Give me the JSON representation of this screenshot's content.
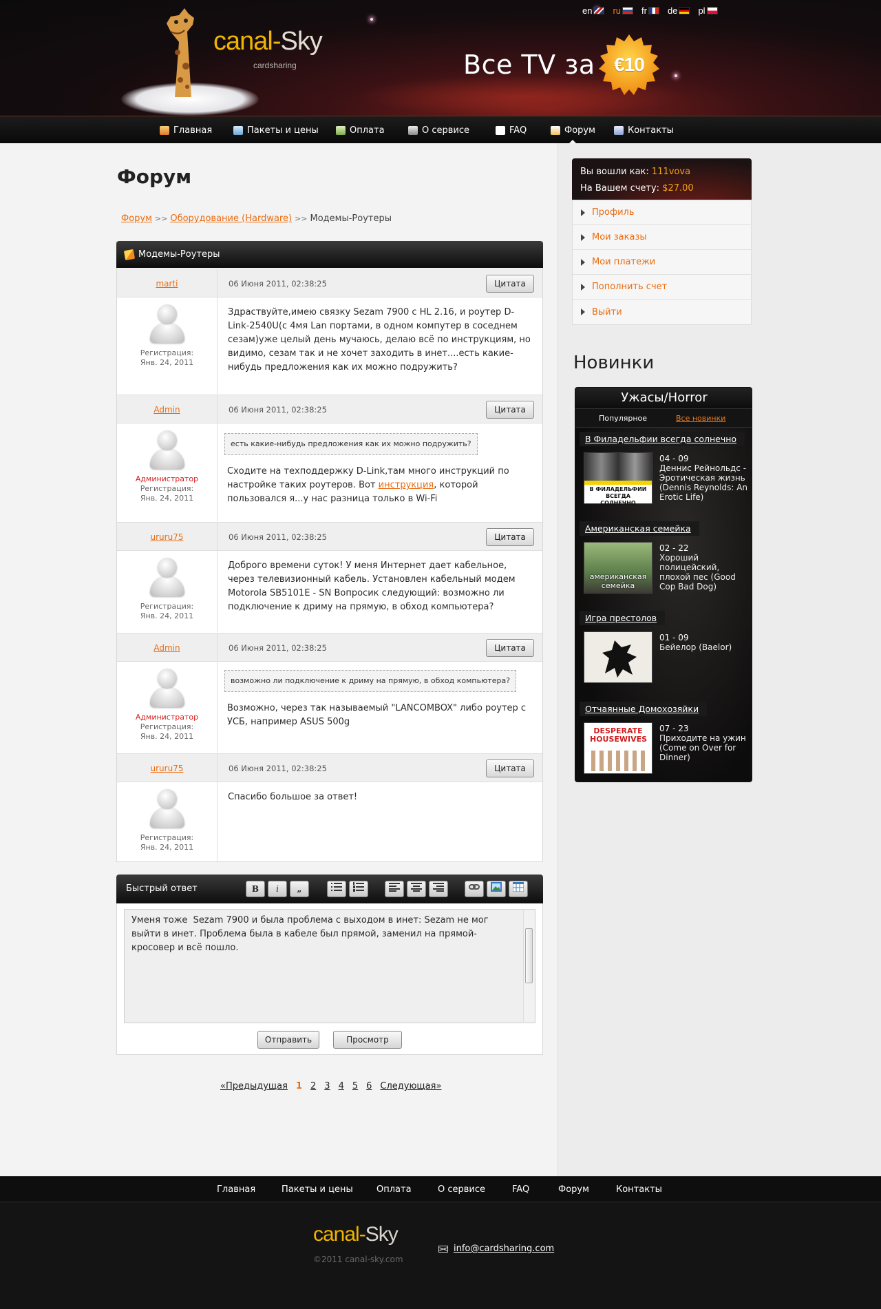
{
  "header": {
    "logo_part1": "canal-",
    "logo_part2": "Sky",
    "logo_sub": "cardsharing",
    "promo_text": "Все TV за",
    "promo_price": "€10",
    "languages": [
      {
        "code": "en",
        "active": false
      },
      {
        "code": "ru",
        "active": true
      },
      {
        "code": "fr",
        "active": false
      },
      {
        "code": "de",
        "active": false
      },
      {
        "code": "pl",
        "active": false
      }
    ]
  },
  "nav": {
    "items": [
      "Главная",
      "Пакеты и цены",
      "Оплата",
      "О сервисе",
      "FAQ",
      "Форум",
      "Контакты"
    ],
    "active": "Форум"
  },
  "page": {
    "title": "Форум",
    "breadcrumb": [
      "Форум",
      "Оборудование (Hardware)",
      "Модемы-Роутеры"
    ],
    "breadcrumb_sep": ">>"
  },
  "topic": {
    "title": "Модемы-Роутеры",
    "quote_label": "Цитата",
    "reg_label": "Регистрация:",
    "posts": [
      {
        "author": "marti",
        "date": "06 Июня 2011, 02:38:25",
        "role": "",
        "reg_date": "Янв. 24, 2011",
        "quote": "",
        "text": "Здраствуйте,имею связку Sezam 7900 с HL 2.16, и роутер D-Link-2540U(с 4мя Lan портами, в одном компутер в соседнем сезам)уже целый день мучаюсь, делаю всё по инструкциям, но видимо, сезам  так и не хочет заходить в инет....есть какие-нибудь предложения как их можно подружить?"
      },
      {
        "author": "Admin",
        "date": "06 Июня 2011, 02:38:25",
        "role": "Администратор",
        "reg_date": "Янв. 24, 2011",
        "quote": "есть какие-нибудь предложения как их можно подружить?",
        "text_before": "Сходите на техподдержку  D-Link,там много инструкций по настройке таких роутеров. Вот ",
        "link": "инструкция",
        "text_after": ", которой пользовался я...у нас разница только в Wi-Fi"
      },
      {
        "author": "ururu75",
        "date": "06 Июня 2011, 02:38:25",
        "role": "",
        "reg_date": "Янв. 24, 2011",
        "quote": "",
        "text": "Доброго времени суток! У меня Интернет дает кабельное, через телевизионный кабель. Установлен кабельный модем Motorola SB5101E - SN Вопросик следующий: возможно ли подключение к дриму на прямую, в обход компьютера?"
      },
      {
        "author": "Admin",
        "date": "06 Июня 2011, 02:38:25",
        "role": "Администратор",
        "reg_date": "Янв. 24, 2011",
        "quote": "возможно ли подключение к дриму на прямую, в обход компьютера?",
        "text": "Возможно, через так называемый \"LANCOMBOX\" либо роутер с УСБ, например ASUS 500g"
      },
      {
        "author": "ururu75",
        "date": "06 Июня 2011, 02:38:25",
        "role": "",
        "reg_date": "Янв. 24, 2011",
        "quote": "",
        "text": "Спасибо большое за ответ!"
      }
    ]
  },
  "reply": {
    "title": "Быстрый ответ",
    "toolbar": [
      "B",
      "i",
      "„"
    ],
    "text": "Уменя тоже  Sezam 7900 и была проблема с выходом в инет: Sezam не мог выйти в инет. Проблема была в кабеле был прямой, заменил на прямой-кросовер и всё пошло.",
    "submit_label": "Отправить",
    "preview_label": "Просмотр"
  },
  "pagination": {
    "prev": "«Предыдущая",
    "pages": [
      "1",
      "2",
      "3",
      "4",
      "5",
      "6"
    ],
    "current": "1",
    "next": "Следующая»"
  },
  "sidebar": {
    "logged_label": "Вы вошли как:",
    "username": "111vova",
    "balance_label": "На Вашем счету:",
    "balance": "$27.00",
    "menu": [
      "Профиль",
      "Мои заказы",
      "Мои платежи",
      "Пополнить счет",
      "Выйти"
    ],
    "news_title": "Новинки",
    "news_category": "Ужасы/Horror",
    "tabs": [
      "Популярное",
      "Все новинки"
    ],
    "selected_tab": "Все новинки",
    "shows": [
      {
        "title": "В Филадельфии всегда солнечно",
        "episode": "04 - 09",
        "ep_title": "Деннис Рейнольдс - Эротическая жизнь (Dennis Reynolds: An Erotic Life)",
        "thumb_text": "В ФИЛАДЕЛЬФИИ ВСЕГДА СОЛНЕЧНО"
      },
      {
        "title": "Американская семейка",
        "episode": "02 - 22",
        "ep_title": "Хороший полицейский, плохой пес (Good Cop Bad Dog)",
        "thumb_text": "американская семейка"
      },
      {
        "title": "Игра престолов",
        "episode": "01 - 09",
        "ep_title": "Бейелор (Baelor)",
        "thumb_text": ""
      },
      {
        "title": "Отчаянные Домохозяйки",
        "episode": "07 - 23",
        "ep_title": "Приходите на ужин (Come on Over for Dinner)",
        "thumb_text": "DESPERATE HOUSEWIVES"
      }
    ]
  },
  "footer": {
    "nav": [
      "Главная",
      "Пакеты и цены",
      "Оплата",
      "О сервисе",
      "FAQ",
      "Форум",
      "Контакты"
    ],
    "logo_part1": "canal-",
    "logo_part2": "Sky",
    "copyright": "©2011  canal-sky.com",
    "email": "info@cardsharing.com"
  }
}
